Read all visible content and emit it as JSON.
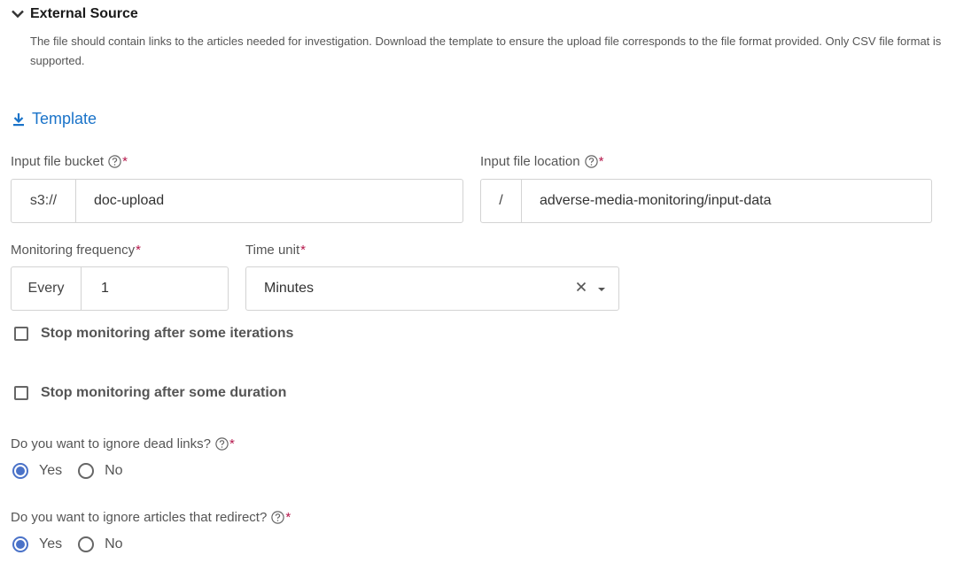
{
  "section": {
    "title": "External Source",
    "description": "The file should contain links to the articles needed for investigation. Download the template to ensure the upload file corresponds to the file format provided. Only CSV file format is supported."
  },
  "template_link": {
    "label": "Template",
    "icon": "download-icon",
    "color": "#1a73c9"
  },
  "bucket": {
    "label": "Input file bucket",
    "required_mark": "*",
    "prefix": "s3://",
    "value": "doc-upload"
  },
  "location": {
    "label": "Input file location",
    "required_mark": "*",
    "prefix": "/",
    "value": "adverse-media-monitoring/input-data"
  },
  "frequency": {
    "label": "Monitoring frequency",
    "required_mark": "*",
    "prefix": "Every",
    "value": "1"
  },
  "time_unit": {
    "label": "Time unit",
    "required_mark": "*",
    "selected": "Minutes"
  },
  "checkboxes": {
    "iterations": {
      "label": "Stop monitoring after some iterations",
      "checked": false
    },
    "duration": {
      "label": "Stop monitoring after some duration",
      "checked": false
    }
  },
  "dead_links": {
    "question": "Do you want to ignore dead links?",
    "required_mark": "*",
    "yes": "Yes",
    "no": "No",
    "selected": "Yes"
  },
  "redirects": {
    "question": "Do you want to ignore articles that redirect?",
    "required_mark": "*",
    "yes": "Yes",
    "no": "No",
    "selected": "Yes"
  },
  "colors": {
    "accent": "#4a72c8",
    "required": "#b5174b",
    "link": "#1a73c9"
  }
}
